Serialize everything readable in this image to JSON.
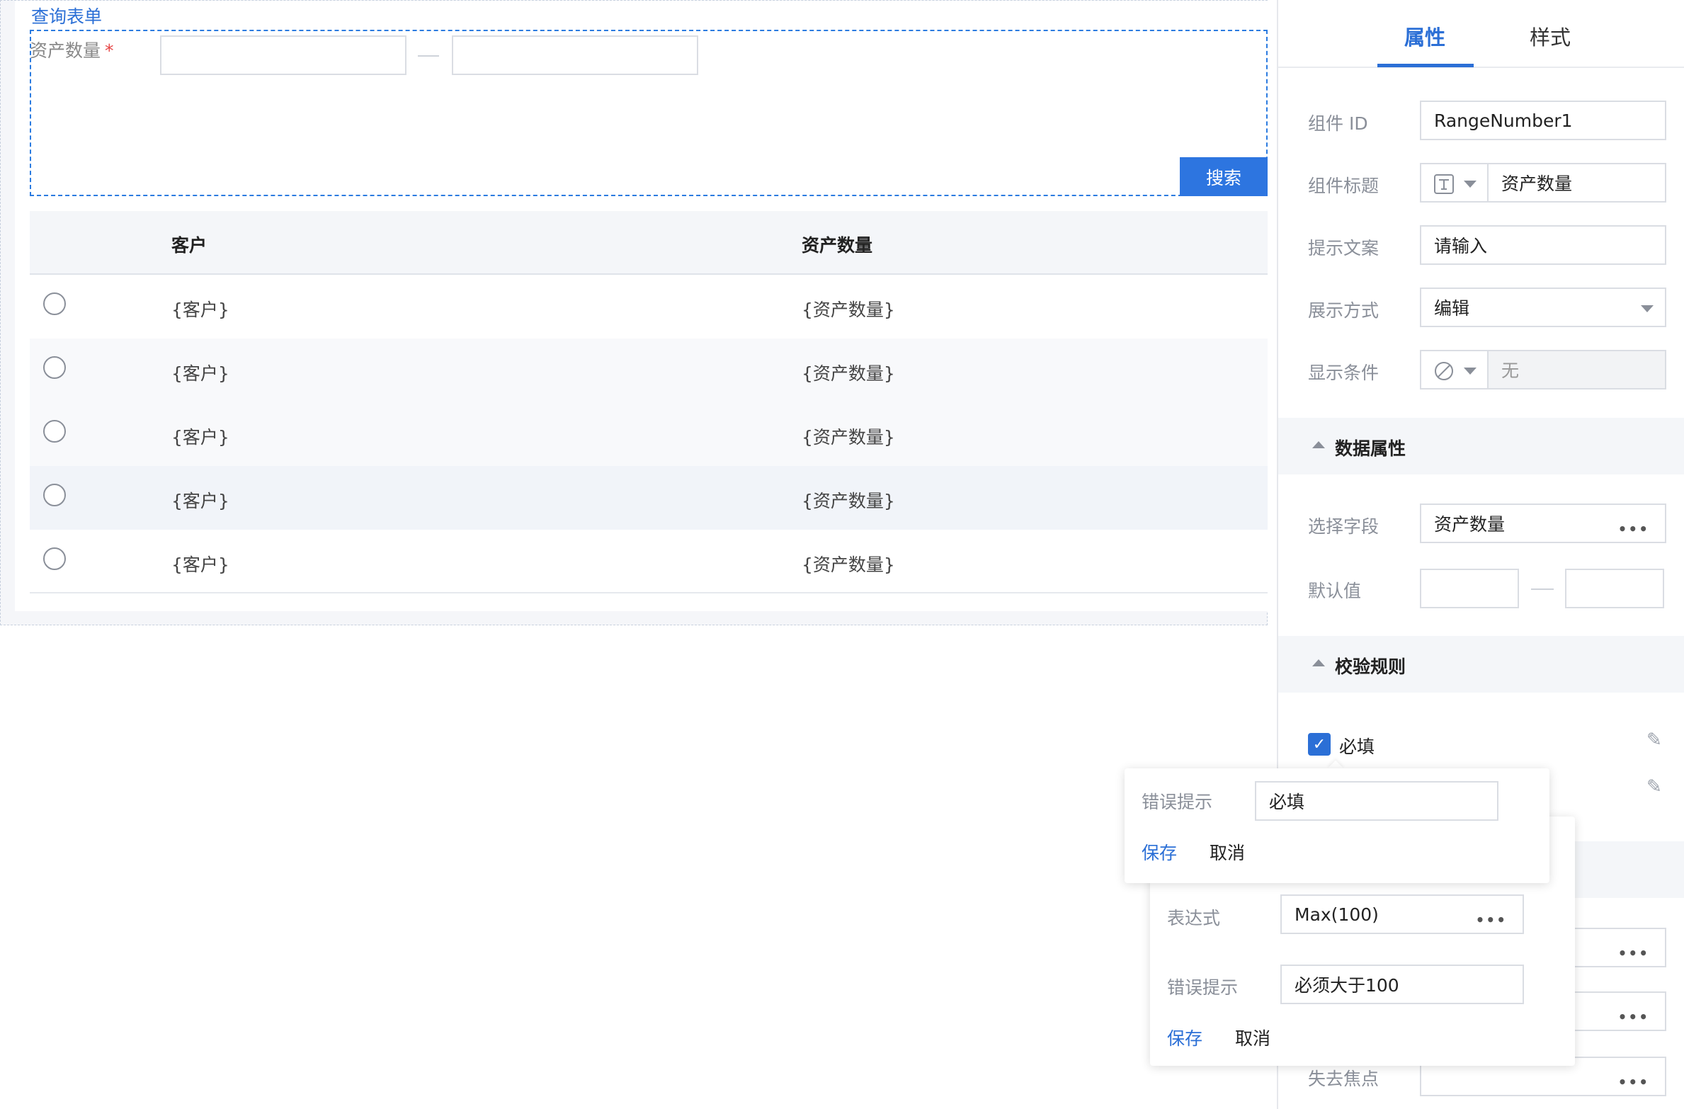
{
  "canvas": {
    "form_title": "查询表单",
    "field_label": "资产数量",
    "required_mark": "*",
    "search_button": "搜索",
    "table": {
      "headers": [
        "客户",
        "资产数量"
      ],
      "rows": [
        [
          "{客户}",
          "{资产数量}"
        ],
        [
          "{客户}",
          "{资产数量}"
        ],
        [
          "{客户}",
          "{资产数量}"
        ],
        [
          "{客户}",
          "{资产数量}"
        ],
        [
          "{客户}",
          "{资产数量}"
        ]
      ]
    }
  },
  "panel": {
    "tabs": [
      "属性",
      "样式"
    ],
    "props": {
      "component_id_label": "组件 ID",
      "component_id_value": "RangeNumber1",
      "title_label": "组件标题",
      "title_value": "资产数量",
      "hint_label": "提示文案",
      "hint_value": "请输入",
      "display_label": "展示方式",
      "display_value": "编辑",
      "condition_label": "显示条件",
      "condition_value": "无"
    },
    "data_section": {
      "title": "数据属性",
      "field_label": "选择字段",
      "field_value": "资产数量",
      "default_label": "默认值"
    },
    "validation_section": {
      "title": "校验规则",
      "required_label": "必填"
    },
    "events": {
      "blur_label": "失去焦点"
    }
  },
  "popover_required": {
    "error_label": "错误提示",
    "error_value": "必填",
    "save": "保存",
    "cancel": "取消"
  },
  "popover_expression": {
    "expr_label": "表达式",
    "expr_value": "Max(100)",
    "error_label": "错误提示",
    "error_value": "必须大于100",
    "save": "保存",
    "cancel": "取消"
  },
  "colors": {
    "accent": "#2b6fd6",
    "required": "#e64545"
  }
}
